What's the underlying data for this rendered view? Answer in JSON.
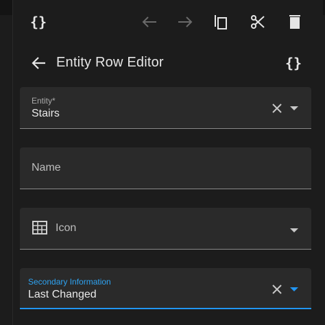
{
  "toolbar": {
    "icons": [
      {
        "name": "code-braces-icon"
      },
      {
        "name": "undo-arrow-icon"
      },
      {
        "name": "redo-arrow-icon"
      },
      {
        "name": "copy-icon"
      },
      {
        "name": "cut-icon"
      },
      {
        "name": "delete-icon"
      }
    ]
  },
  "editor": {
    "title": "Entity Row Editor",
    "back_icon": "arrow-left-icon",
    "code_icon": "code-braces-icon"
  },
  "fields": {
    "entity": {
      "label": "Entity*",
      "value": "Stairs"
    },
    "name": {
      "label": "Name",
      "value": ""
    },
    "icon": {
      "label": "Icon",
      "value": "",
      "prefix_icon": "stairs-icon"
    },
    "secondary_info": {
      "label": "Secondary Information",
      "value": "Last Changed"
    }
  },
  "colors": {
    "accent": "#2196f3",
    "background": "#1c1c1c",
    "field_bg": "#2a2a2a",
    "text": "#e1e1e1"
  }
}
